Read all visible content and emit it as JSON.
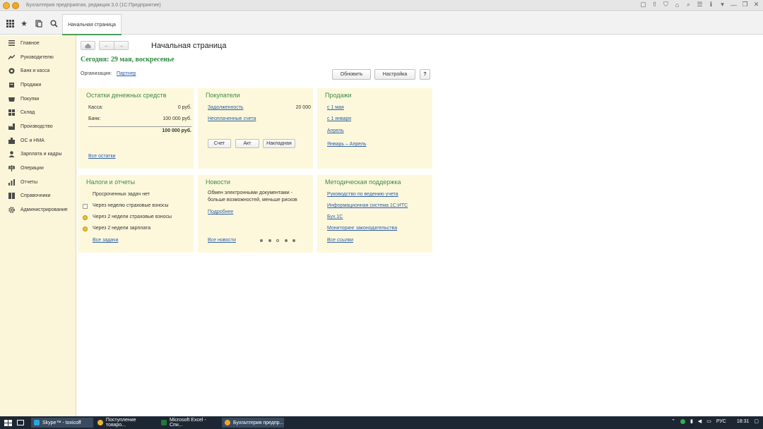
{
  "window": {
    "title": "Бухгалтерия предприятия, редакция 3.0  (1С:Предприятие)",
    "controls": [
      "▢",
      "⇧",
      "⛉",
      "⌂",
      "⌕",
      "☰",
      "ℹ",
      "▾",
      "—",
      "❐",
      "✕"
    ]
  },
  "toolbar": {
    "tab_label": "Начальная страница"
  },
  "sidebar": {
    "items": [
      {
        "label": "Главное",
        "icon": "menu-icon"
      },
      {
        "label": "Руководителю",
        "icon": "chart-line-icon"
      },
      {
        "label": "Банк и касса",
        "icon": "coins-icon"
      },
      {
        "label": "Продажи",
        "icon": "cart-icon"
      },
      {
        "label": "Покупки",
        "icon": "basket-icon"
      },
      {
        "label": "Склад",
        "icon": "warehouse-icon"
      },
      {
        "label": "Производство",
        "icon": "factory-icon"
      },
      {
        "label": "ОС и НМА",
        "icon": "assets-icon"
      },
      {
        "label": "Зарплата и кадры",
        "icon": "person-icon"
      },
      {
        "label": "Операции",
        "icon": "scales-icon"
      },
      {
        "label": "Отчеты",
        "icon": "report-icon"
      },
      {
        "label": "Справочники",
        "icon": "book-icon"
      },
      {
        "label": "Администрирование",
        "icon": "gear-icon"
      }
    ]
  },
  "main": {
    "title": "Начальная страница",
    "today": "Сегодня: 29 мая, воскресенье",
    "org_label": "Организация:",
    "org_value": "Партнер",
    "refresh_label": "Обновить",
    "settings_label": "Настройка",
    "help_label": "?"
  },
  "panels": {
    "cash": {
      "title": "Остатки денежных средств",
      "kassa_label": "Касса:",
      "kassa_value": "0 руб.",
      "bank_label": "Банк:",
      "bank_value": "100 000 руб.",
      "total_value": "100 000 руб.",
      "all_link": "Все остатки"
    },
    "buyers": {
      "title": "Покупатели",
      "debt_link": "Задолженность",
      "debt_value": "20 000",
      "unpaid_link": "Неоплаченные счета",
      "btn_invoice": "Счет",
      "btn_act": "Акт",
      "btn_waybill": "Накладная"
    },
    "sales": {
      "title": "Продажи",
      "links": [
        "с 1 мая",
        "с 1 января",
        "Апрель",
        "Январь – Апрель"
      ]
    },
    "taxes": {
      "title": "Налоги и отчеты",
      "no_overdue": "Просроченных задач нет",
      "tasks": [
        "Через неделю страховые взносы",
        "Через 2 недели страховые взносы",
        "Через 2 недели зарплата"
      ],
      "all_link": "Все задачи"
    },
    "news": {
      "title": "Новости",
      "text_1": "Обмен электронными документами -",
      "text_2": "больше возможностей, меньше рисков",
      "more_link": "Подробнее",
      "all_link": "Все новости"
    },
    "support": {
      "title": "Методическая поддержка",
      "links": [
        "Руководство по ведению учета",
        "Информационная система 1С:ИТС",
        "Бух.1С",
        "Мониторинг законодательства",
        "Все ссылки"
      ]
    }
  },
  "taskbar": {
    "items": [
      "Skype™ - toxicoff",
      "Поступление товаро...",
      "Microsoft Excel - Спи...",
      "Бухгалтерия предпр..."
    ],
    "lang": "РУС",
    "time": "18:31"
  }
}
